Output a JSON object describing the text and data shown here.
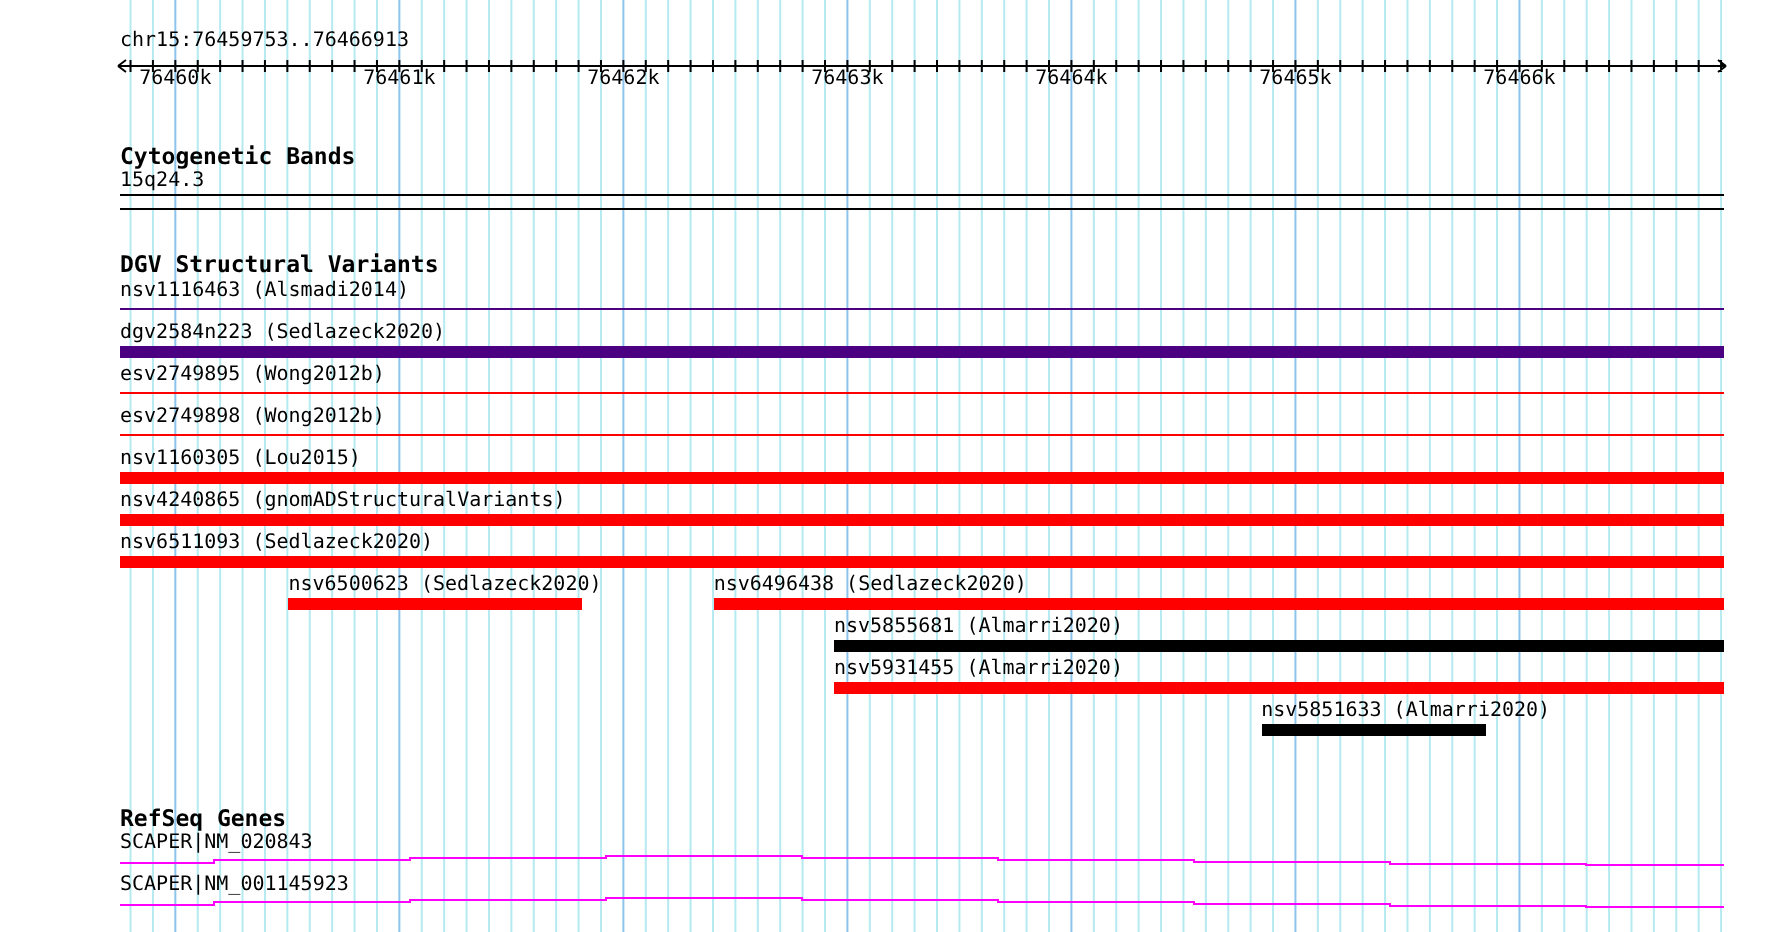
{
  "ruler": {
    "location": "chr15:76459753..76466913",
    "tick_labels": [
      "76460k",
      "76461k",
      "76462k",
      "76463k",
      "76464k",
      "76465k",
      "76466k"
    ]
  },
  "tracks": [
    {
      "kind": "cytoband",
      "title": "Cytogenetic Bands",
      "label": "15q24.3"
    },
    {
      "kind": "variants",
      "title": "DGV Structural Variants",
      "rows": [
        {
          "features": [
            {
              "label": "nsv1116463 (Alsmadi2014)",
              "kind": "thin",
              "color": "#4b0082"
            }
          ]
        },
        {
          "features": [
            {
              "label": "dgv2584n223 (Sedlazeck2020)",
              "kind": "thick",
              "color": "#4b0082"
            }
          ]
        },
        {
          "features": [
            {
              "label": "esv2749895 (Wong2012b)",
              "kind": "thin",
              "color": "#ff0000"
            }
          ]
        },
        {
          "features": [
            {
              "label": "esv2749898 (Wong2012b)",
              "kind": "thin",
              "color": "#ff0000"
            }
          ]
        },
        {
          "features": [
            {
              "label": "nsv1160305 (Lou2015)",
              "kind": "thick",
              "color": "#ff0000"
            }
          ]
        },
        {
          "features": [
            {
              "label": "nsv4240865 (gnomADStructuralVariants)",
              "kind": "thick",
              "color": "#ff0000"
            }
          ]
        },
        {
          "features": [
            {
              "label": "nsv6511093 (Sedlazeck2020)",
              "kind": "thick",
              "color": "#ff0000"
            }
          ]
        },
        {
          "features": [
            {
              "label": "nsv6500623 (Sedlazeck2020)",
              "kind": "thick",
              "color": "#ff0000"
            },
            {
              "label": "nsv6496438 (Sedlazeck2020)",
              "kind": "thick",
              "color": "#ff0000"
            }
          ]
        },
        {
          "features": [
            {
              "label": "nsv5855681 (Almarri2020)",
              "kind": "thick",
              "color": "#000000"
            }
          ]
        },
        {
          "features": [
            {
              "label": "nsv5931455 (Almarri2020)",
              "kind": "thick",
              "color": "#ff0000"
            }
          ]
        },
        {
          "features": [
            {
              "label": "nsv5851633 (Almarri2020)",
              "kind": "thick",
              "color": "#000000"
            }
          ]
        }
      ]
    },
    {
      "kind": "genes",
      "title": "RefSeq Genes",
      "genes": [
        {
          "label": "SCAPER|NM_020843",
          "color": "#ff00ff"
        },
        {
          "label": "SCAPER|NM_001145923",
          "color": "#ff00ff"
        }
      ]
    }
  ]
}
